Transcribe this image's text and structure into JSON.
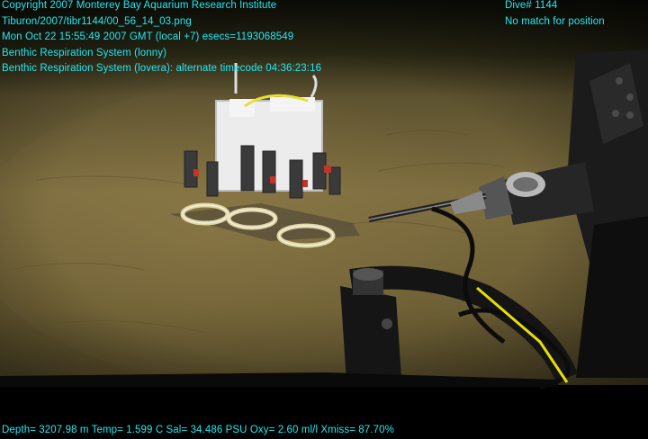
{
  "overlay": {
    "copyright": "Copyright 2007 Monterey Bay Aquarium Research Institute",
    "file_path": "Tiburon/2007/tibr1144/00_56_14_03.png",
    "timestamp": "Mon Oct 22 15:55:49 2007 GMT (local +7)  esecs=1193068549",
    "line_lonny": "Benthic Respiration System (lonny)",
    "line_lovera": "Benthic Respiration System (lovera): alternate timecode 04:36:23:16",
    "dive": "Dive# 1144",
    "position_status": "No match for position",
    "telemetry": "Depth= 3207.98 m  Temp= 1.599 C  Sal= 34.486 PSU  Oxy= 2.60 ml/l  Xmiss= 87.70%"
  },
  "colors": {
    "overlay_text": "#21e9f2",
    "sediment": "#7a6a3c",
    "water": "#15160d",
    "instrument_frame": "#eeeeee",
    "cable_yellow": "#e8e000"
  }
}
